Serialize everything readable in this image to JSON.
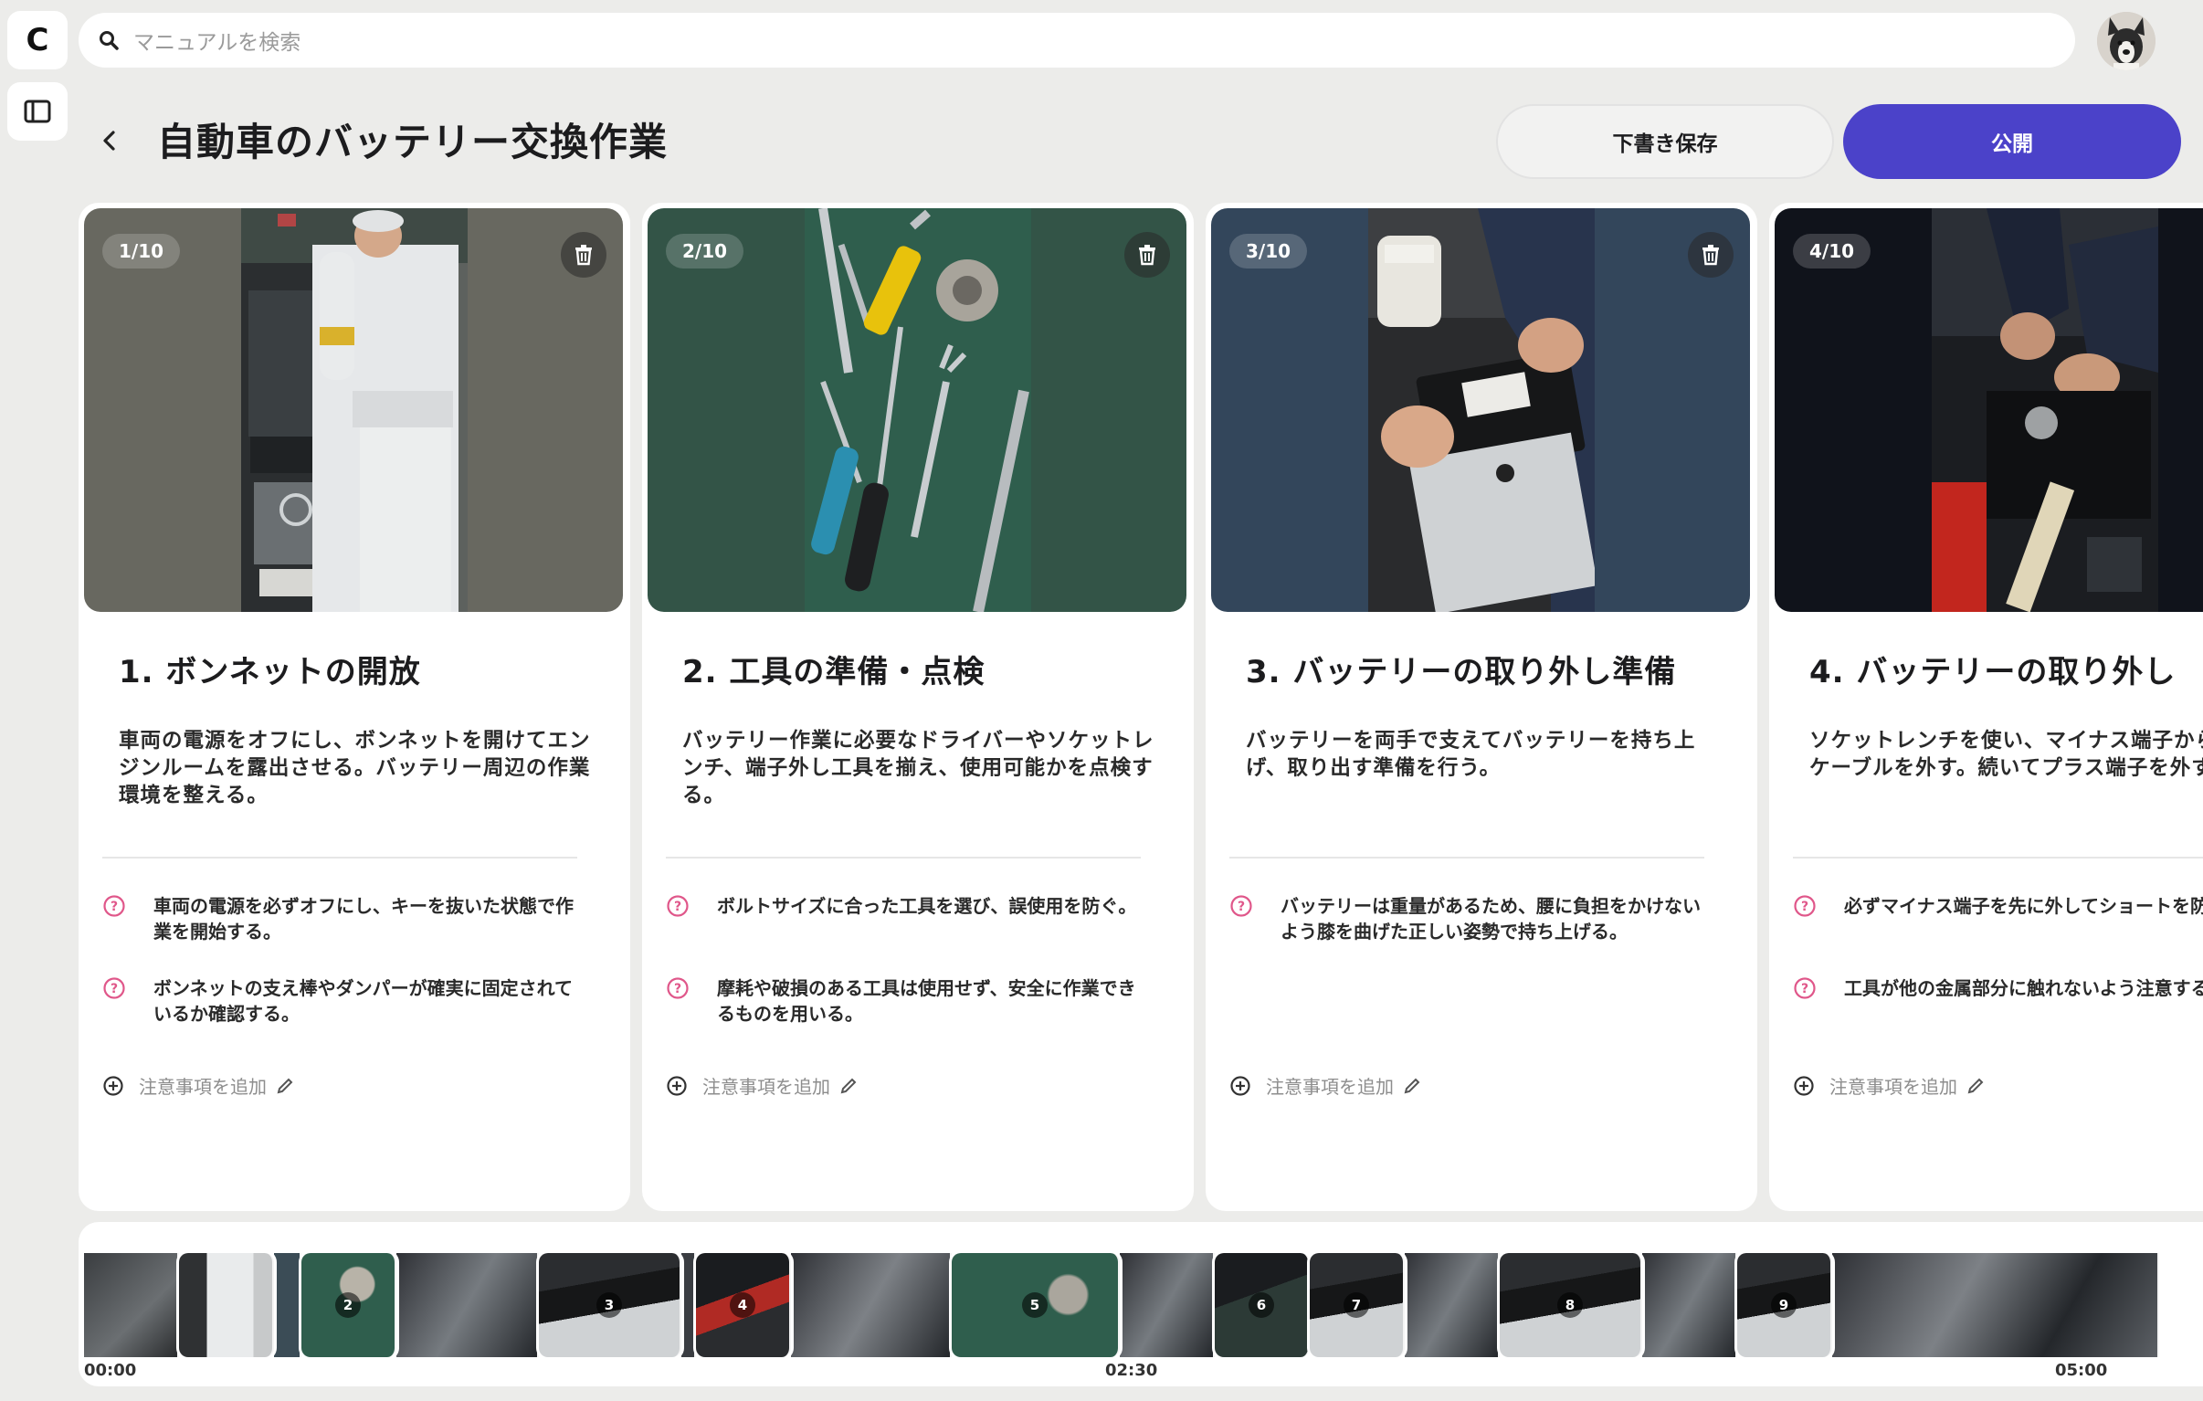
{
  "app": {
    "logo_letter": "C"
  },
  "search": {
    "placeholder": "マニュアルを検索"
  },
  "header": {
    "title": "自動車のバッテリー交換作業",
    "draft_label": "下書き保存",
    "publish_label": "公開"
  },
  "colors": {
    "accent": "#4b42c9",
    "card1_bg": "#686860",
    "card2_bg": "#335447",
    "card3_bg": "#33465b",
    "card4_bg": "#10131b",
    "note_icon": "#e0578a"
  },
  "cards": [
    {
      "badge": "1/10",
      "title": "1. ボンネットの開放",
      "desc": "車両の電源をオフにし、ボンネットを開けてエンジンルームを露出させる。バッテリー周辺の作業環境を整える。",
      "notes": [
        "車両の電源を必ずオフにし、キーを抜いた状態で作業を開始する。",
        "ボンネットの支え棒やダンパーが確実に固定されているか確認する。"
      ],
      "add_note": "注意事項を追加",
      "photo_icon": "worker-opening-hood"
    },
    {
      "badge": "2/10",
      "title": "2. 工具の準備・点検",
      "desc": "バッテリー作業に必要なドライバーやソケットレンチ、端子外し工具を揃え、使用可能かを点検する。",
      "notes": [
        "ボルトサイズに合った工具を選び、誤使用を防ぐ。",
        "摩耗や破損のある工具は使用せず、安全に作業できるものを用いる。"
      ],
      "add_note": "注意事項を追加",
      "photo_icon": "tools-on-green-mat"
    },
    {
      "badge": "3/10",
      "title": "3. バッテリーの取り外し準備",
      "desc": "バッテリーを両手で支えてバッテリーを持ち上げ、取り出す準備を行う。",
      "notes": [
        "バッテリーは重量があるため、腰に負担をかけないよう膝を曲げた正しい姿勢で持ち上げる。"
      ],
      "add_note": "注意事項を追加",
      "photo_icon": "hands-lifting-battery"
    },
    {
      "badge": "4/10",
      "title": "4. バッテリーの取り外し",
      "desc": "ソケットレンチを使い、マイナス端子から緩めてケーブルを外す。続いてプラス端子を外す。",
      "notes": [
        "必ずマイナス端子を先に外してショートを防ぐ。",
        "工具が他の金属部分に触れないよう注意する。"
      ],
      "add_note": "注意事項を追加",
      "photo_icon": "wrench-on-terminal"
    }
  ],
  "timeline": {
    "start": "00:00",
    "mid": "02:30",
    "end": "05:00",
    "markers": [
      "2",
      "3",
      "4",
      "5",
      "6",
      "7",
      "8",
      "9"
    ]
  }
}
